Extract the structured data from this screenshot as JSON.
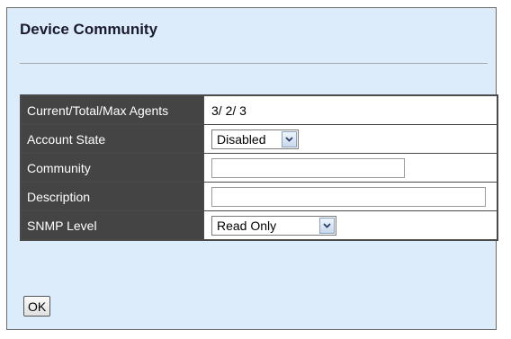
{
  "page": {
    "title": "Device Community"
  },
  "form": {
    "agents_label": "Current/Total/Max Agents",
    "agents_value": "3/ 2/ 3",
    "account_state_label": "Account State",
    "account_state_value": "Disabled",
    "community_label": "Community",
    "community_value": "",
    "description_label": "Description",
    "description_value": "",
    "snmp_level_label": "SNMP Level",
    "snmp_level_value": "Read Only"
  },
  "actions": {
    "ok_label": "OK"
  },
  "icons": {
    "dropdown": "chevron-down-icon"
  }
}
